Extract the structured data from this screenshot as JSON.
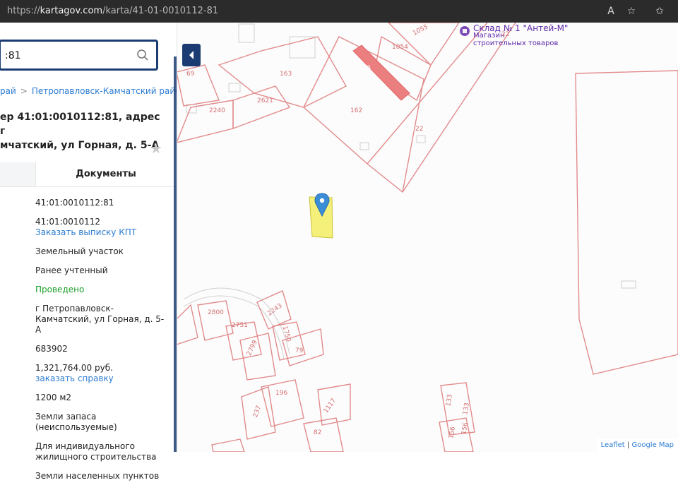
{
  "browser": {
    "url_proto": "https://",
    "url_host": "kartagov.com",
    "url_path": "/karta/41-01-0010112-81"
  },
  "panel": {
    "search_value": ":81",
    "breadcrumb": [
      "рай",
      "Петропавловск-Камчатский район"
    ],
    "title": "ер 41:01:0010112:81, адрес г\nмчатский, ул Горная, д. 5-А",
    "tabs": {
      "docs": "Документы"
    },
    "details": [
      {
        "text": "41:01:0010112:81"
      },
      {
        "text": "41:01:0010112",
        "link": "Заказать выписку КПТ"
      },
      {
        "text": "Земельный участок"
      },
      {
        "text": "Ранее учтенный"
      },
      {
        "text": "Проведено",
        "color": "#1a9f2a"
      },
      {
        "text": "г Петропавловск-\nКамчатский, ул Горная, д. 5-А"
      },
      {
        "text": "683902"
      },
      {
        "text": "1,321,764.00 руб.",
        "link": "заказать справку"
      },
      {
        "text": "1200 м2"
      },
      {
        "text": "Земли запаса\n(неиспользуемые)"
      },
      {
        "text": "Для индивидуального\nжилищного строительства"
      },
      {
        "text": "Земли населенных пунктов"
      }
    ]
  },
  "map": {
    "labels": [
      {
        "t": "1055"
      },
      {
        "t": "1054"
      },
      {
        "t": "163"
      },
      {
        "t": "69"
      },
      {
        "t": "2621"
      },
      {
        "t": "2240"
      },
      {
        "t": "225"
      },
      {
        "t": "162"
      },
      {
        "t": "22"
      },
      {
        "t": "22"
      },
      {
        "t": "2800"
      },
      {
        "t": "2243"
      },
      {
        "t": "2751"
      },
      {
        "t": "1750"
      },
      {
        "t": "79"
      },
      {
        "t": "2799"
      },
      {
        "t": "196"
      },
      {
        "t": "237"
      },
      {
        "t": "1117"
      },
      {
        "t": "82"
      },
      {
        "t": "133"
      },
      {
        "t": "133"
      },
      {
        "t": "156"
      },
      {
        "t": "156"
      }
    ],
    "poi": {
      "name": "Склад № 1 \"Антей-М\"",
      "line2": "Магазин",
      "line3": "строительных товаров"
    },
    "attribution": {
      "leaflet": "Leaflet",
      "google": "Google Map"
    }
  },
  "colors": {
    "accent": "#1b3c73",
    "parcel": "#e28b8b",
    "highlight": "#f5f07a",
    "marker": "#3b8ed6",
    "link": "#2b7bd1"
  }
}
